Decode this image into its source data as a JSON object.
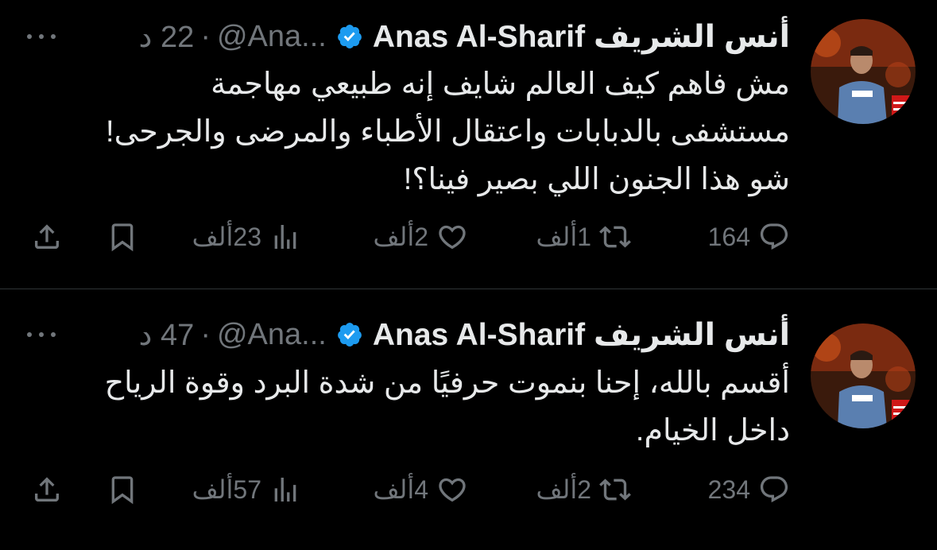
{
  "tweets": [
    {
      "author_name": "أنس الشريف Anas Al-Sharif",
      "handle": "@Ana...",
      "time": "22 د",
      "separator": "·",
      "text_lines": [
        "مش فاهم كيف العالم شايف إنه طبيعي مهاجمة",
        "مستشفى بالدبابات واعتقال الأطباء والمرضى والجرحى!",
        "شو هذا الجنون اللي بصير فينا؟!"
      ],
      "replies": "164",
      "reposts": "1ألف",
      "likes": "2ألف",
      "views": "23ألف"
    },
    {
      "author_name": "أنس الشريف Anas Al-Sharif",
      "handle": "@Ana...",
      "time": "47 د",
      "separator": "·",
      "text_lines": [
        "أقسم بالله، إحنا بنموت حرفيًا من شدة البرد وقوة الرياح",
        "داخل الخيام."
      ],
      "replies": "234",
      "reposts": "2ألف",
      "likes": "4ألف",
      "views": "57ألف"
    }
  ],
  "colors": {
    "background": "#000000",
    "text": "#e7e9ea",
    "muted": "#71767b",
    "verified": "#1d9bf0",
    "divider": "#2f3336"
  },
  "icons": [
    "verified-badge-icon",
    "more-icon",
    "reply-icon",
    "repost-icon",
    "like-icon",
    "views-icon",
    "bookmark-icon",
    "share-icon"
  ]
}
